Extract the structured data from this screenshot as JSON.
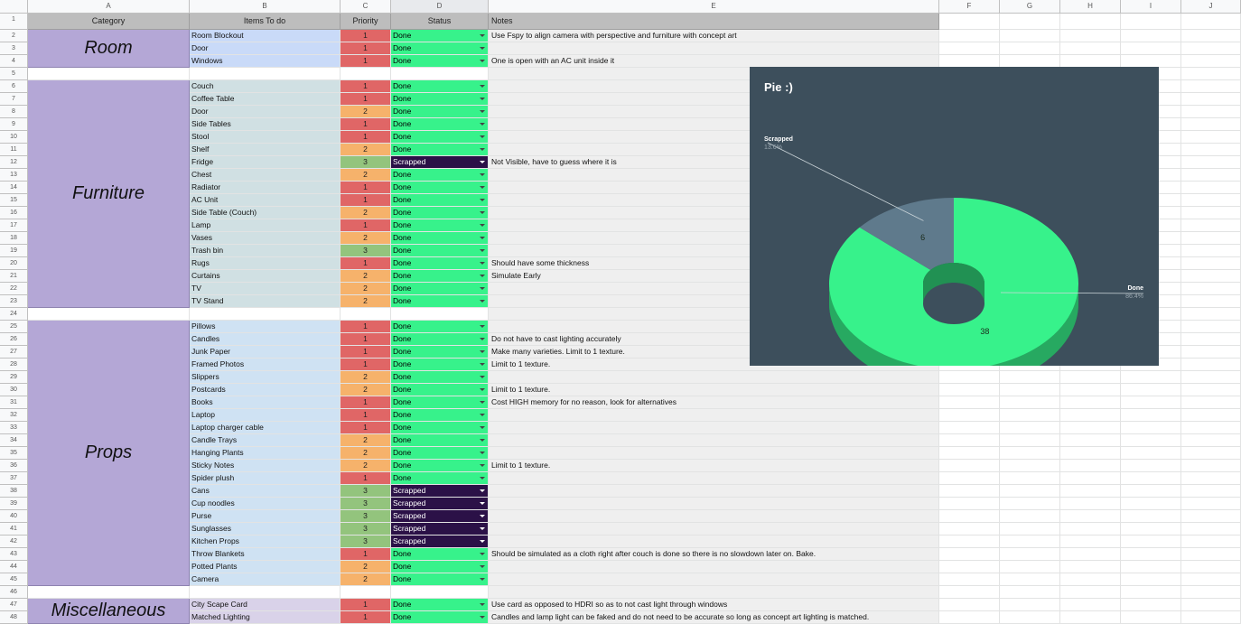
{
  "colors": {
    "done": "#37f28b",
    "scrapped": "#2b1147",
    "priority_1": "#e06666",
    "priority_2": "#f6b26b",
    "priority_3": "#93c47d",
    "category_bg": "#b4a7d6",
    "room_items_bg": "#c9daf8",
    "furniture_items_bg": "#d0e0e3",
    "props_items_bg": "#cfe2f3",
    "misc_items_bg": "#d9d2e9",
    "notes_bg": "#efefef",
    "chart_bg": "#3d4f5c"
  },
  "columns": [
    "A",
    "B",
    "C",
    "D",
    "E",
    "F",
    "G",
    "H",
    "I",
    "J"
  ],
  "header": {
    "category": "Category",
    "items": "Items To do",
    "priority": "Priority",
    "status": "Status",
    "notes": "Notes"
  },
  "sections": [
    {
      "name": "Room",
      "first_row": 2,
      "last_row": 4,
      "items_color": "#c9daf8"
    },
    {
      "name": "Furniture",
      "first_row": 6,
      "last_row": 23,
      "items_color": "#d0e0e3"
    },
    {
      "name": "Props",
      "first_row": 25,
      "last_row": 45,
      "items_color": "#cfe2f3"
    },
    {
      "name": "Miscellaneous",
      "first_row": 47,
      "last_row": 48,
      "items_color": "#d9d2e9"
    }
  ],
  "rows": [
    {
      "row": 2,
      "item": "Room Blockout",
      "priority": "1",
      "status": "Done",
      "note": "Use Fspy to align camera with perspective and furniture with concept art"
    },
    {
      "row": 3,
      "item": "Door",
      "priority": "1",
      "status": "Done",
      "note": ""
    },
    {
      "row": 4,
      "item": "Windows",
      "priority": "1",
      "status": "Done",
      "note": "One is open with an AC unit inside it"
    },
    {
      "row": 6,
      "item": "Couch",
      "priority": "1",
      "status": "Done",
      "note": ""
    },
    {
      "row": 7,
      "item": "Coffee Table",
      "priority": "1",
      "status": "Done",
      "note": ""
    },
    {
      "row": 8,
      "item": "Door",
      "priority": "2",
      "status": "Done",
      "note": ""
    },
    {
      "row": 9,
      "item": "Side Tables",
      "priority": "1",
      "status": "Done",
      "note": ""
    },
    {
      "row": 10,
      "item": "Stool",
      "priority": "1",
      "status": "Done",
      "note": ""
    },
    {
      "row": 11,
      "item": "Shelf",
      "priority": "2",
      "status": "Done",
      "note": ""
    },
    {
      "row": 12,
      "item": "Fridge",
      "priority": "3",
      "status": "Scrapped",
      "note": "Not Visible, have to guess where it is"
    },
    {
      "row": 13,
      "item": "Chest",
      "priority": "2",
      "status": "Done",
      "note": ""
    },
    {
      "row": 14,
      "item": "Radiator",
      "priority": "1",
      "status": "Done",
      "note": ""
    },
    {
      "row": 15,
      "item": "AC Unit",
      "priority": "1",
      "status": "Done",
      "note": ""
    },
    {
      "row": 16,
      "item": "Side Table (Couch)",
      "priority": "2",
      "status": "Done",
      "note": ""
    },
    {
      "row": 17,
      "item": "Lamp",
      "priority": "1",
      "status": "Done",
      "note": ""
    },
    {
      "row": 18,
      "item": "Vases",
      "priority": "2",
      "status": "Done",
      "note": ""
    },
    {
      "row": 19,
      "item": "Trash bin",
      "priority": "3",
      "status": "Done",
      "note": ""
    },
    {
      "row": 20,
      "item": "Rugs",
      "priority": "1",
      "status": "Done",
      "note": "Should have some thickness"
    },
    {
      "row": 21,
      "item": "Curtains",
      "priority": "2",
      "status": "Done",
      "note": "Simulate Early"
    },
    {
      "row": 22,
      "item": "TV",
      "priority": "2",
      "status": "Done",
      "note": ""
    },
    {
      "row": 23,
      "item": "TV Stand",
      "priority": "2",
      "status": "Done",
      "note": ""
    },
    {
      "row": 25,
      "item": "Pillows",
      "priority": "1",
      "status": "Done",
      "note": ""
    },
    {
      "row": 26,
      "item": "Candles",
      "priority": "1",
      "status": "Done",
      "note": "Do not have to cast lighting accurately"
    },
    {
      "row": 27,
      "item": "Junk Paper",
      "priority": "1",
      "status": "Done",
      "note": "Make many varieties. Limit to 1 texture."
    },
    {
      "row": 28,
      "item": "Framed Photos",
      "priority": "1",
      "status": "Done",
      "note": "Limit to 1 texture."
    },
    {
      "row": 29,
      "item": "Slippers",
      "priority": "2",
      "status": "Done",
      "note": ""
    },
    {
      "row": 30,
      "item": "Postcards",
      "priority": "2",
      "status": "Done",
      "note": "Limit to 1 texture."
    },
    {
      "row": 31,
      "item": "Books",
      "priority": "1",
      "status": "Done",
      "note": "Cost HIGH memory for no reason, look for alternatives"
    },
    {
      "row": 32,
      "item": "Laptop",
      "priority": "1",
      "status": "Done",
      "note": ""
    },
    {
      "row": 33,
      "item": "Laptop charger cable",
      "priority": "1",
      "status": "Done",
      "note": ""
    },
    {
      "row": 34,
      "item": "Candle Trays",
      "priority": "2",
      "status": "Done",
      "note": ""
    },
    {
      "row": 35,
      "item": "Hanging Plants",
      "priority": "2",
      "status": "Done",
      "note": ""
    },
    {
      "row": 36,
      "item": "Sticky Notes",
      "priority": "2",
      "status": "Done",
      "note": "Limit to 1 texture."
    },
    {
      "row": 37,
      "item": "Spider plush",
      "priority": "1",
      "status": "Done",
      "note": ""
    },
    {
      "row": 38,
      "item": "Cans",
      "priority": "3",
      "status": "Scrapped",
      "note": ""
    },
    {
      "row": 39,
      "item": "Cup noodles",
      "priority": "3",
      "status": "Scrapped",
      "note": ""
    },
    {
      "row": 40,
      "item": "Purse",
      "priority": "3",
      "status": "Scrapped",
      "note": ""
    },
    {
      "row": 41,
      "item": "Sunglasses",
      "priority": "3",
      "status": "Scrapped",
      "note": ""
    },
    {
      "row": 42,
      "item": "Kitchen Props",
      "priority": "3",
      "status": "Scrapped",
      "note": ""
    },
    {
      "row": 43,
      "item": "Throw Blankets",
      "priority": "1",
      "status": "Done",
      "note": "Should be simulated as a cloth right after couch is done so there is no slowdown later on. Bake."
    },
    {
      "row": 44,
      "item": "Potted Plants",
      "priority": "2",
      "status": "Done",
      "note": ""
    },
    {
      "row": 45,
      "item": "Camera",
      "priority": "2",
      "status": "Done",
      "note": ""
    },
    {
      "row": 47,
      "item": "City Scape Card",
      "priority": "1",
      "status": "Done",
      "note": "Use card as opposed to HDRI so as to not cast light through windows"
    },
    {
      "row": 48,
      "item": "Matched Lighting",
      "priority": "1",
      "status": "Done",
      "note": "Candles and lamp light can be faked and do not need to be accurate so long as concept art lighting is matched."
    }
  ],
  "chart_data": {
    "type": "pie",
    "style": "3d donut",
    "title": "Pie :)",
    "slices": [
      {
        "label": "Done",
        "value": 38,
        "percent_label": "86.4%",
        "color": "#37f28b"
      },
      {
        "label": "Scrapped",
        "value": 6,
        "percent_label": "13.6%",
        "color": "#5f7a8c"
      }
    ],
    "legend": "callout labels"
  }
}
